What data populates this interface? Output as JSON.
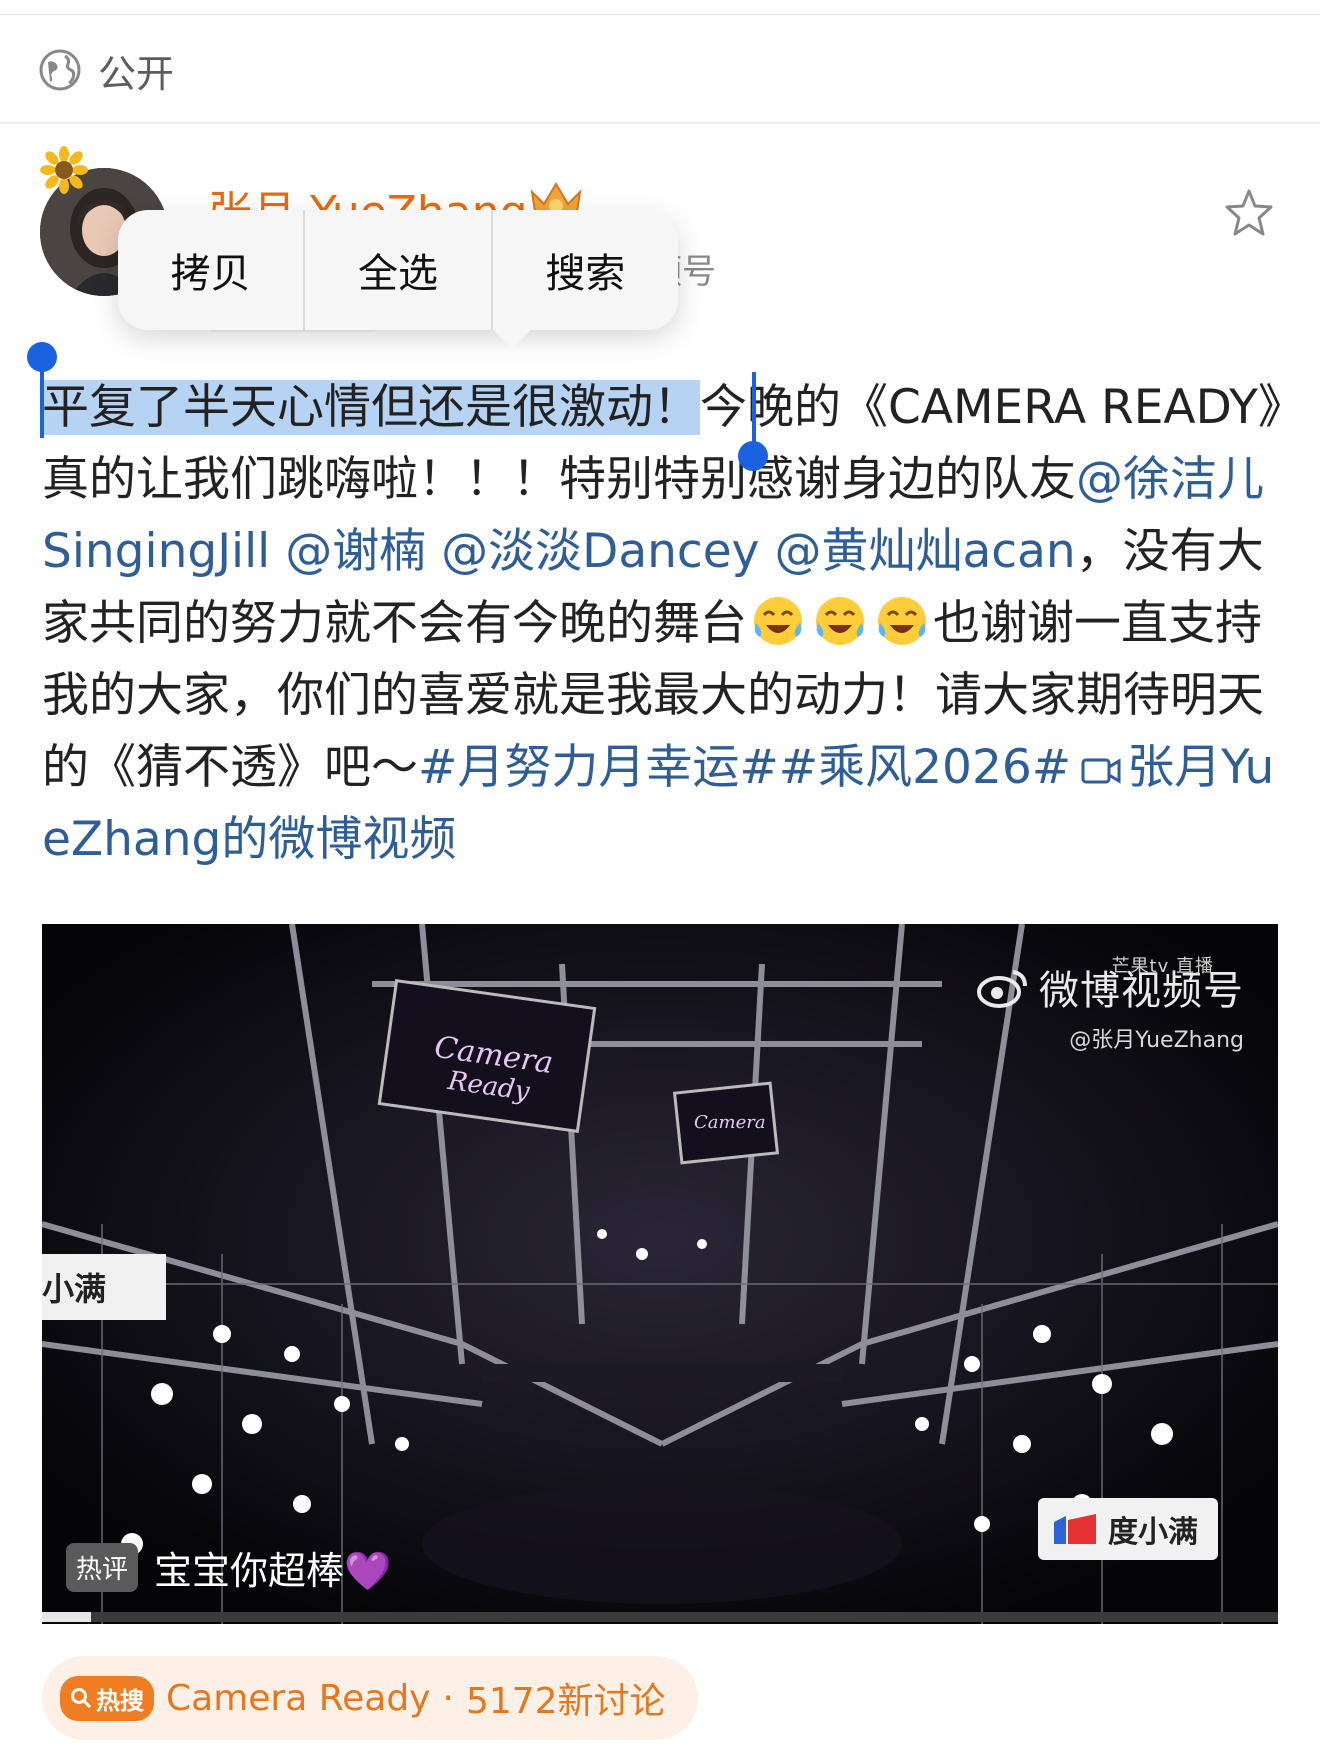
{
  "visibility": {
    "label": "公开",
    "icon": "globe-icon"
  },
  "author": {
    "name": "张月 YueZhang",
    "info_fragment": "频号"
  },
  "selection_menu": {
    "copy": "拷贝",
    "select_all": "全选",
    "search": "搜索"
  },
  "post": {
    "selected_text": "平复了半天心情但还是很激动！",
    "seg1": "今晚的《CAMERA READY》真的让我们跳嗨啦！！！特别特别感谢身边的队友",
    "mention1": "@徐洁儿SingingJill",
    "mention2": "@谢楠",
    "mention3": "@淡淡Dancey",
    "mention4": "@黄灿灿acan",
    "seg2": "，没有大家共同的努力就不会有今晚的舞台",
    "seg3": "也谢谢一直支持我的大家，你们的喜爱就是我最大的动力！请大家期待明天的《猜不透》吧～",
    "hashtag1": "#月努力月幸运#",
    "hashtag2": "#乘风2026#",
    "video_link": "张月YueZhang的微博视频"
  },
  "video": {
    "watermark_brand": "微博视频号",
    "watermark_small": "芒果tv 直播",
    "watermark_handle": "@张月YueZhang",
    "sponsor": "度小满",
    "sponsor_partial": "度小满",
    "hot_comment_tag": "热评",
    "hot_comment": "宝宝你超棒💜",
    "screen_text": "Camera Ready",
    "progress": 0.04
  },
  "hot_search": {
    "badge": "热搜",
    "title": "Camera Ready",
    "separator": "·",
    "count": "5172新讨论"
  }
}
